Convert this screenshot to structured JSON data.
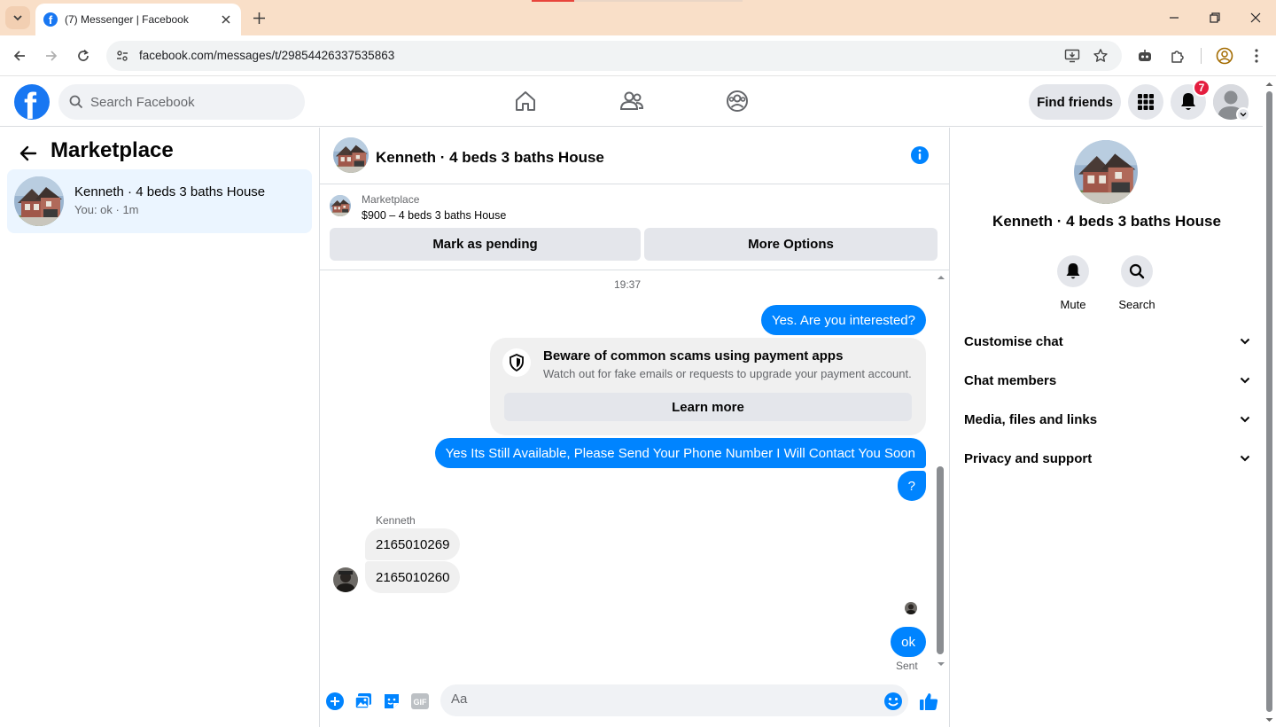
{
  "browser": {
    "tab_title": "(7) Messenger | Facebook",
    "url": "facebook.com/messages/t/29854426337535863"
  },
  "fb": {
    "search_placeholder": "Search Facebook",
    "find_friends": "Find friends",
    "notification_count": "7"
  },
  "left": {
    "title": "Marketplace",
    "conversations": [
      {
        "name": "Kenneth · 4 beds 3 baths House",
        "snippet": "You: ok · 1m"
      }
    ]
  },
  "chat": {
    "header_name": "Kenneth · 4 beds 3 baths House",
    "listing": {
      "label": "Marketplace",
      "price_title": "$900 – 4 beds 3 baths House",
      "mark_pending": "Mark as pending",
      "more_options": "More Options"
    },
    "timestamp": "19:37",
    "messages": {
      "out1": "Yes. Are you interested?",
      "scam_title": "Beware of common scams using payment apps",
      "scam_desc": "Watch out for fake emails or requests to upgrade your payment account.",
      "scam_button": "Learn more",
      "out2": "Yes Its Still Available, Please Send Your Phone Number I Will Contact You Soon",
      "out3": "?",
      "sender": "Kenneth",
      "in1": "2165010269",
      "in2": "2165010260",
      "out4": "ok",
      "status": "Sent"
    },
    "composer_placeholder": "Aa",
    "gif_label": "GIF"
  },
  "right": {
    "name": "Kenneth · 4 beds 3 baths House",
    "actions": {
      "mute": "Mute",
      "search": "Search"
    },
    "sections": [
      "Customise chat",
      "Chat members",
      "Media, files and links",
      "Privacy and support"
    ]
  },
  "colors": {
    "accent": "#0084ff",
    "brand": "#1877f2",
    "selected_bg": "#ebf5ff",
    "badge": "#e41e3f"
  }
}
